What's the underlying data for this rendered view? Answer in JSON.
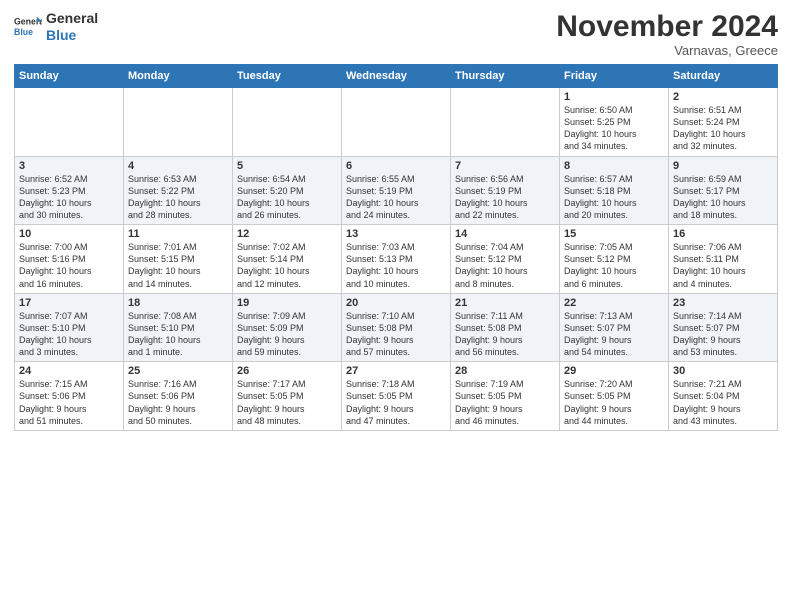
{
  "header": {
    "logo": {
      "line1": "General",
      "line2": "Blue"
    },
    "title": "November 2024",
    "subtitle": "Varnavas, Greece"
  },
  "weekdays": [
    "Sunday",
    "Monday",
    "Tuesday",
    "Wednesday",
    "Thursday",
    "Friday",
    "Saturday"
  ],
  "weeks": [
    [
      {
        "day": "",
        "info": ""
      },
      {
        "day": "",
        "info": ""
      },
      {
        "day": "",
        "info": ""
      },
      {
        "day": "",
        "info": ""
      },
      {
        "day": "",
        "info": ""
      },
      {
        "day": "1",
        "info": "Sunrise: 6:50 AM\nSunset: 5:25 PM\nDaylight: 10 hours\nand 34 minutes."
      },
      {
        "day": "2",
        "info": "Sunrise: 6:51 AM\nSunset: 5:24 PM\nDaylight: 10 hours\nand 32 minutes."
      }
    ],
    [
      {
        "day": "3",
        "info": "Sunrise: 6:52 AM\nSunset: 5:23 PM\nDaylight: 10 hours\nand 30 minutes."
      },
      {
        "day": "4",
        "info": "Sunrise: 6:53 AM\nSunset: 5:22 PM\nDaylight: 10 hours\nand 28 minutes."
      },
      {
        "day": "5",
        "info": "Sunrise: 6:54 AM\nSunset: 5:20 PM\nDaylight: 10 hours\nand 26 minutes."
      },
      {
        "day": "6",
        "info": "Sunrise: 6:55 AM\nSunset: 5:19 PM\nDaylight: 10 hours\nand 24 minutes."
      },
      {
        "day": "7",
        "info": "Sunrise: 6:56 AM\nSunset: 5:19 PM\nDaylight: 10 hours\nand 22 minutes."
      },
      {
        "day": "8",
        "info": "Sunrise: 6:57 AM\nSunset: 5:18 PM\nDaylight: 10 hours\nand 20 minutes."
      },
      {
        "day": "9",
        "info": "Sunrise: 6:59 AM\nSunset: 5:17 PM\nDaylight: 10 hours\nand 18 minutes."
      }
    ],
    [
      {
        "day": "10",
        "info": "Sunrise: 7:00 AM\nSunset: 5:16 PM\nDaylight: 10 hours\nand 16 minutes."
      },
      {
        "day": "11",
        "info": "Sunrise: 7:01 AM\nSunset: 5:15 PM\nDaylight: 10 hours\nand 14 minutes."
      },
      {
        "day": "12",
        "info": "Sunrise: 7:02 AM\nSunset: 5:14 PM\nDaylight: 10 hours\nand 12 minutes."
      },
      {
        "day": "13",
        "info": "Sunrise: 7:03 AM\nSunset: 5:13 PM\nDaylight: 10 hours\nand 10 minutes."
      },
      {
        "day": "14",
        "info": "Sunrise: 7:04 AM\nSunset: 5:12 PM\nDaylight: 10 hours\nand 8 minutes."
      },
      {
        "day": "15",
        "info": "Sunrise: 7:05 AM\nSunset: 5:12 PM\nDaylight: 10 hours\nand 6 minutes."
      },
      {
        "day": "16",
        "info": "Sunrise: 7:06 AM\nSunset: 5:11 PM\nDaylight: 10 hours\nand 4 minutes."
      }
    ],
    [
      {
        "day": "17",
        "info": "Sunrise: 7:07 AM\nSunset: 5:10 PM\nDaylight: 10 hours\nand 3 minutes."
      },
      {
        "day": "18",
        "info": "Sunrise: 7:08 AM\nSunset: 5:10 PM\nDaylight: 10 hours\nand 1 minute."
      },
      {
        "day": "19",
        "info": "Sunrise: 7:09 AM\nSunset: 5:09 PM\nDaylight: 9 hours\nand 59 minutes."
      },
      {
        "day": "20",
        "info": "Sunrise: 7:10 AM\nSunset: 5:08 PM\nDaylight: 9 hours\nand 57 minutes."
      },
      {
        "day": "21",
        "info": "Sunrise: 7:11 AM\nSunset: 5:08 PM\nDaylight: 9 hours\nand 56 minutes."
      },
      {
        "day": "22",
        "info": "Sunrise: 7:13 AM\nSunset: 5:07 PM\nDaylight: 9 hours\nand 54 minutes."
      },
      {
        "day": "23",
        "info": "Sunrise: 7:14 AM\nSunset: 5:07 PM\nDaylight: 9 hours\nand 53 minutes."
      }
    ],
    [
      {
        "day": "24",
        "info": "Sunrise: 7:15 AM\nSunset: 5:06 PM\nDaylight: 9 hours\nand 51 minutes."
      },
      {
        "day": "25",
        "info": "Sunrise: 7:16 AM\nSunset: 5:06 PM\nDaylight: 9 hours\nand 50 minutes."
      },
      {
        "day": "26",
        "info": "Sunrise: 7:17 AM\nSunset: 5:05 PM\nDaylight: 9 hours\nand 48 minutes."
      },
      {
        "day": "27",
        "info": "Sunrise: 7:18 AM\nSunset: 5:05 PM\nDaylight: 9 hours\nand 47 minutes."
      },
      {
        "day": "28",
        "info": "Sunrise: 7:19 AM\nSunset: 5:05 PM\nDaylight: 9 hours\nand 46 minutes."
      },
      {
        "day": "29",
        "info": "Sunrise: 7:20 AM\nSunset: 5:05 PM\nDaylight: 9 hours\nand 44 minutes."
      },
      {
        "day": "30",
        "info": "Sunrise: 7:21 AM\nSunset: 5:04 PM\nDaylight: 9 hours\nand 43 minutes."
      }
    ]
  ]
}
